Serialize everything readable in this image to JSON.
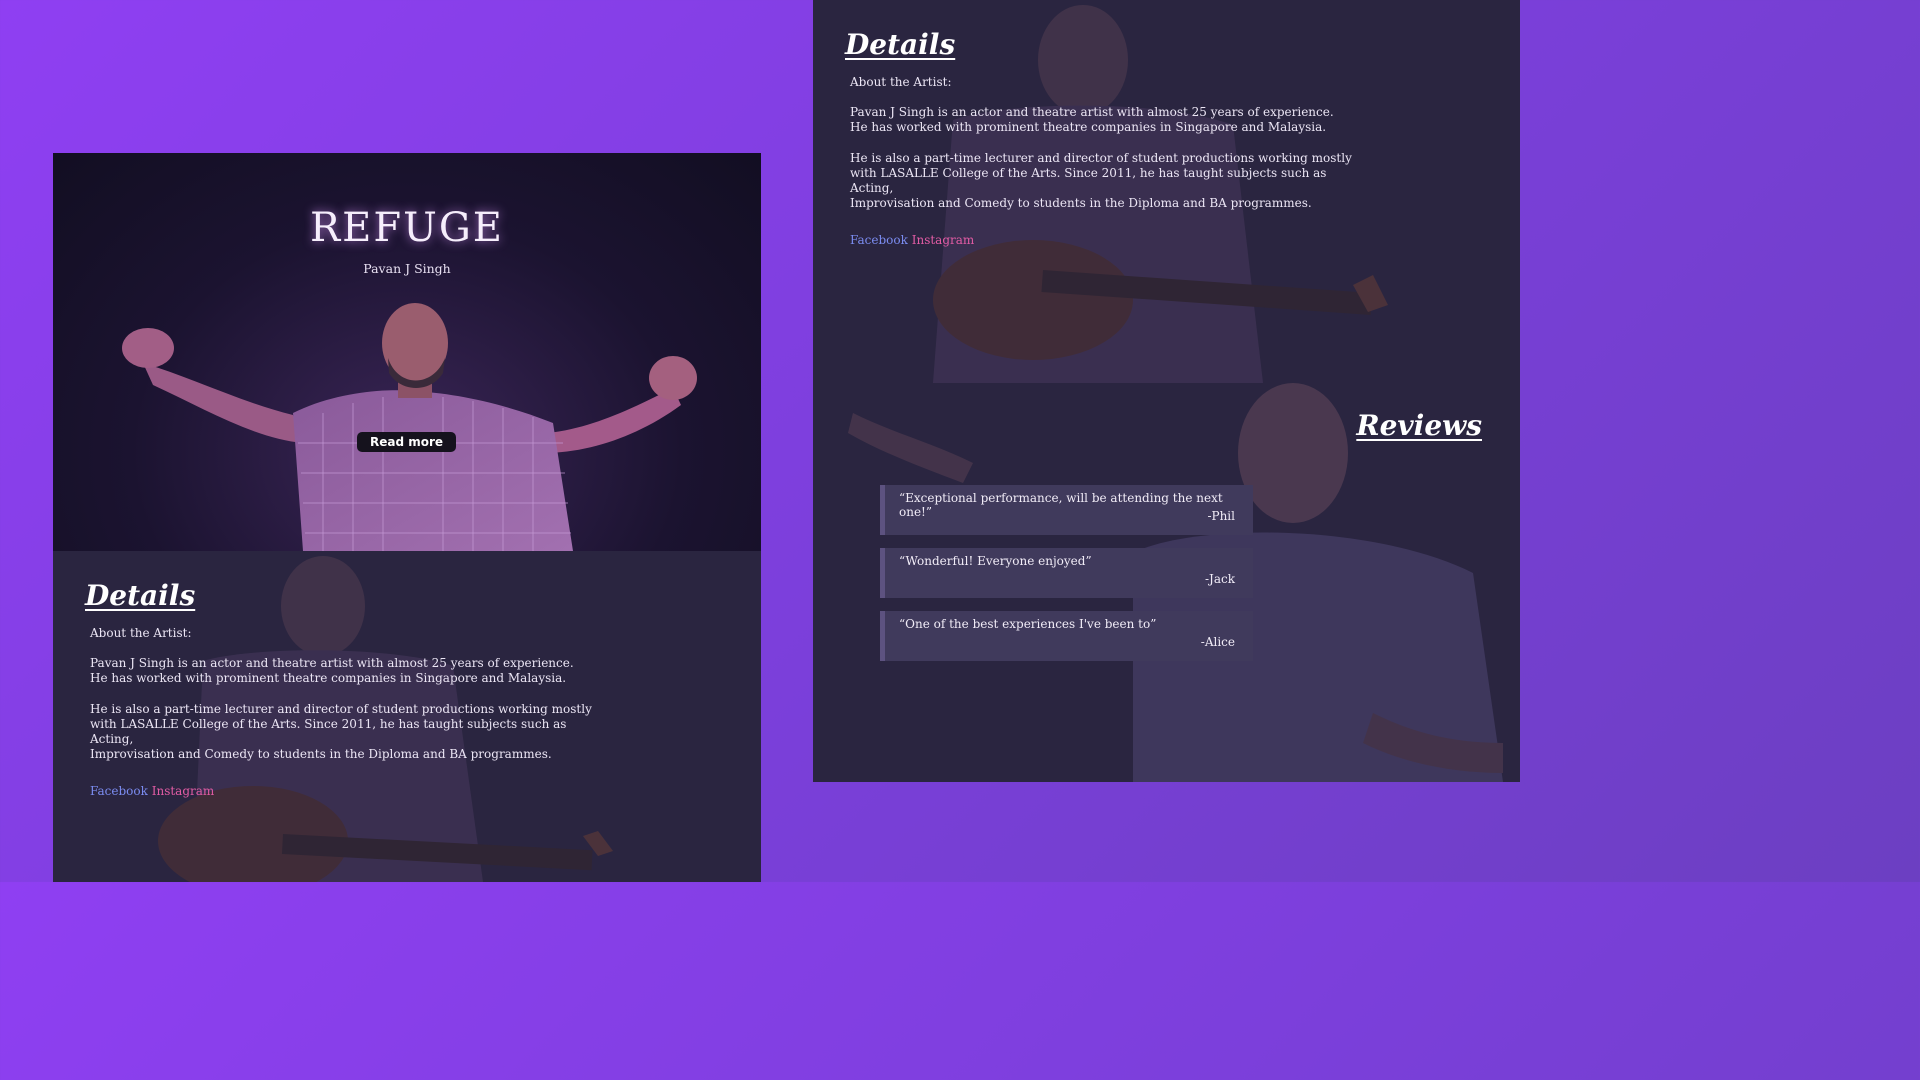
{
  "hero": {
    "title": "REFUGE",
    "subtitle": "Pavan J Singh",
    "read_more_label": "Read more"
  },
  "details": {
    "heading": "Details",
    "about_title": "About the Artist:",
    "paragraph_1": "Pavan J Singh is an actor and theatre artist with almost 25 years of experience.\nHe has worked with prominent theatre companies in Singapore and Malaysia.",
    "paragraph_2": "He is also a part-time lecturer and director of student productions working mostly\nwith LASALLE College of the Arts. Since 2011, he has taught subjects such as Acting,\nImprovisation and Comedy to students in the Diploma and BA programmes.",
    "links": {
      "facebook": "Facebook",
      "instagram": "Instagram"
    }
  },
  "reviews": {
    "heading": "Reviews",
    "items": [
      {
        "quote": "“Exceptional performance, will be attending the next one!”",
        "author": "-Phil"
      },
      {
        "quote": "“Wonderful! Everyone enjoyed”",
        "author": "-Jack"
      },
      {
        "quote": "“One of the best experiences I've been to”",
        "author": "-Alice"
      }
    ]
  },
  "colors": {
    "background_purple": "#8f3ff2",
    "panel_dark": "#2a2540",
    "facebook_link": "#7b8cf0",
    "instagram_link": "#e35ca5"
  }
}
